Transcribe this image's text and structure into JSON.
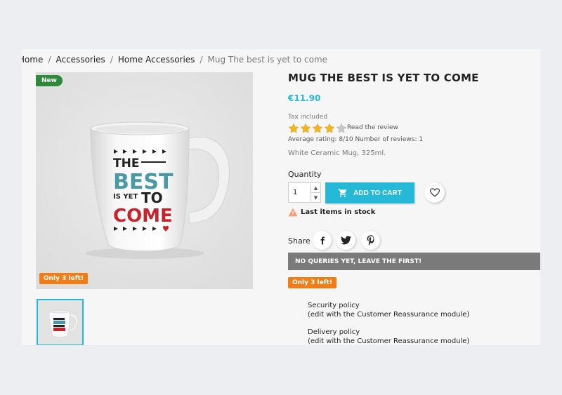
{
  "breadcrumb": [
    {
      "label": "Home"
    },
    {
      "label": "Accessories"
    },
    {
      "label": "Home Accessories"
    },
    {
      "label": "Mug The best is yet to come"
    }
  ],
  "product": {
    "title": "MUG THE BEST IS YET TO COME",
    "price": "€11.90",
    "tax_label": "Tax included",
    "description": "White Ceramic Mug, 325ml.",
    "flag_new": "New",
    "flag_stock": "Only 3 left!",
    "image_text": {
      "line1": "THE",
      "line2": "BEST",
      "line3a": "IS YET",
      "line3b": "TO",
      "line4": "COME"
    }
  },
  "reviews": {
    "stars_filled": 4,
    "stars_total": 5,
    "read_review": "Read the review",
    "average_rating_text": "Average rating: 8/10 Number of reviews: 1"
  },
  "purchase": {
    "quantity_label": "Quantity",
    "quantity_value": "1",
    "add_to_cart": "ADD TO CART",
    "stock_message": "Last items in stock"
  },
  "share": {
    "label": "Share",
    "networks": [
      "facebook-icon",
      "twitter-icon",
      "pinterest-icon"
    ]
  },
  "queries_bar": "NO QUERIES YET, LEAVE THE FIRST!",
  "reassurance": [
    {
      "title": "Security policy",
      "subtitle": "(edit with the Customer Reassurance module)"
    },
    {
      "title": "Delivery policy",
      "subtitle": "(edit with the Customer Reassurance module)"
    }
  ],
  "colors": {
    "accent": "#25b9d7",
    "new_flag": "#2c8a3a",
    "stock_flag": "#f37c14",
    "star": "#f5b71e",
    "queries_bar": "#7a7a7a"
  }
}
